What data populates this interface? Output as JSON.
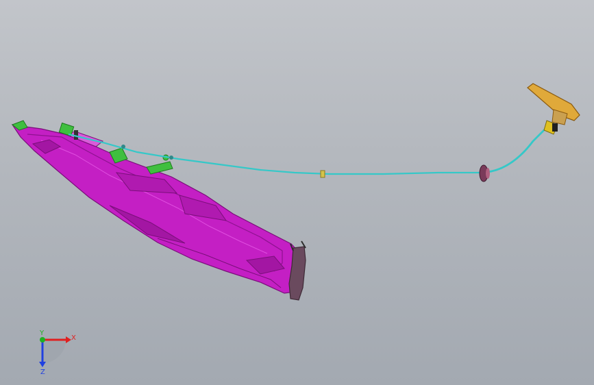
{
  "viewport": {
    "background_top": "#c2c5ca",
    "background_bottom": "#a3a9b1"
  },
  "model": {
    "parts": [
      {
        "name": "hood-panel",
        "color": "#c41fc4"
      },
      {
        "name": "release-cable",
        "color": "#35c8c8"
      },
      {
        "name": "release-handle",
        "color": "#e0a93a"
      },
      {
        "name": "latch-clips",
        "color": "#3fbf3f"
      },
      {
        "name": "grommet",
        "color": "#7a3a5a"
      },
      {
        "name": "end-bracket",
        "color": "#6a4a5e"
      }
    ]
  },
  "triad": {
    "x_label": "X",
    "y_label": "Y",
    "z_label": "Z",
    "x_color": "#e02020",
    "y_color": "#20b020",
    "z_color": "#2040e0"
  }
}
